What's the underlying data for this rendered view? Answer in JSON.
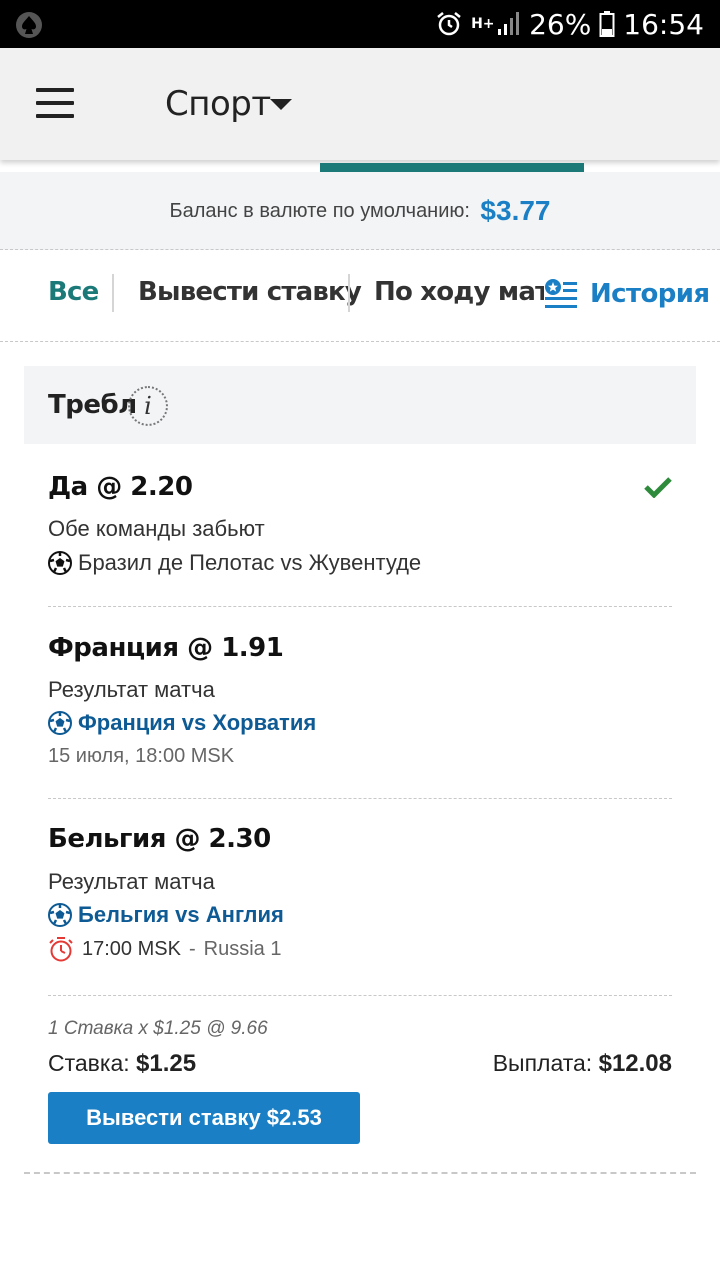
{
  "status_bar": {
    "battery": "26%",
    "time": "16:54",
    "network": "H+"
  },
  "app_bar": {
    "title": "Спорт"
  },
  "balance": {
    "label": "Баланс в валюте по умолчанию:",
    "amount": "$3.77"
  },
  "filters": {
    "all": "Все",
    "cashout": "Вывести ставку",
    "live": "По ходу матча",
    "history": "История"
  },
  "bet": {
    "type": "Требл",
    "legs": [
      {
        "selection": "Да @ 2.20",
        "market": "Обе команды забьют",
        "event": "Бразил де Пелотас vs Жувентуде",
        "settled_won": true
      },
      {
        "selection": "Франция @ 1.91",
        "market": "Результат матча",
        "event": "Франция vs Хорватия",
        "time": "15 июля, 18:00 MSK"
      },
      {
        "selection": "Бельгия @ 2.30",
        "market": "Результат матча",
        "event": "Бельгия vs Англия",
        "time": "17:00 MSK",
        "channel": "Russia 1"
      }
    ],
    "summary": "1 Ставка x $1.25 @ 9.66",
    "stake_label": "Ставка:",
    "stake": "$1.25",
    "payout_label": "Выплата:",
    "payout": "$12.08",
    "cashout_button": "Вывести ставку $2.53"
  },
  "colors": {
    "accent_blue": "#1a7fc4",
    "teal": "#1b7a78",
    "link_blue": "#0d5a94",
    "check_green": "#2e8b3c",
    "timer_red": "#e53935"
  }
}
